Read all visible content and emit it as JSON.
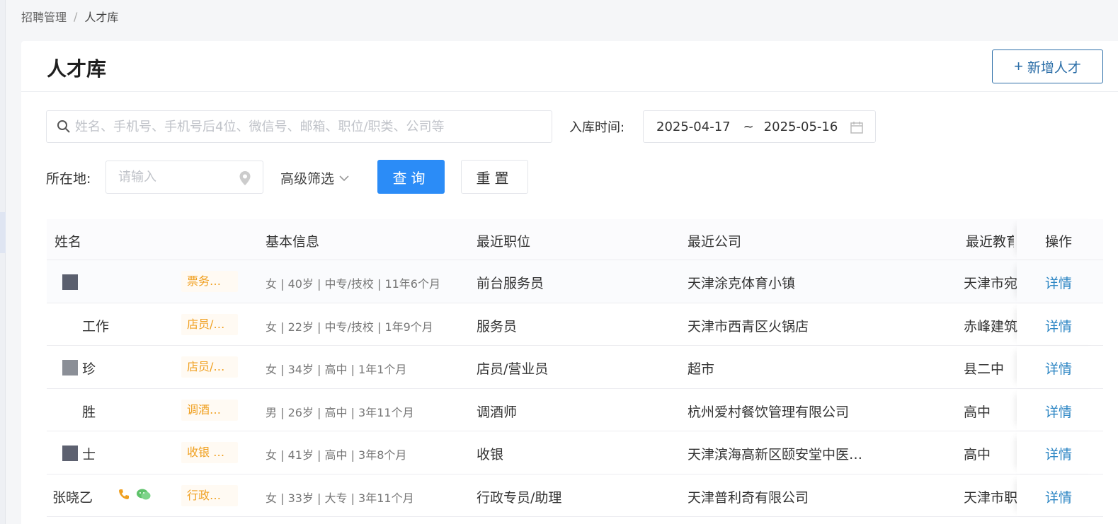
{
  "breadcrumb": {
    "parent": "招聘管理",
    "separator": "/",
    "current": "人才库"
  },
  "page_title": "人才库",
  "add_button": {
    "plus": "+",
    "label": "新增人才"
  },
  "search": {
    "placeholder": "姓名、手机号、手机号后4位、微信号、邮箱、职位/职类、公司等"
  },
  "date_filter": {
    "label": "入库时间:",
    "start": "2025-04-17",
    "tilde": "~",
    "end": "2025-05-16"
  },
  "location_filter": {
    "label": "所在地:",
    "placeholder": "请输入"
  },
  "advanced_filter": "高级筛选",
  "query_button": "查询",
  "reset_button": "重置",
  "table": {
    "headers": {
      "name": "姓名",
      "basic": "基本信息",
      "position": "最近职位",
      "company": "最近公司",
      "education": "最近教育",
      "action": "操作"
    },
    "rows": [
      {
        "name": "",
        "tag": "票务…",
        "basic": "女 | 40岁 | 中专/技校 | 11年6个月",
        "position": "前台服务员",
        "company": "天津涂克体育小镇",
        "education": "天津市宛",
        "action": "详情",
        "avatar_color": "#5a5f6e"
      },
      {
        "name": "工作",
        "tag": "店员/…",
        "basic": "女 | 22岁 | 中专/技校 | 1年9个月",
        "position": "服务员",
        "company": "天津市西青区火锅店",
        "education": "赤峰建筑",
        "action": "详情",
        "avatar_color": ""
      },
      {
        "name": "珍",
        "tag": "店员/…",
        "basic": "女 | 34岁 | 高中 | 1年1个月",
        "position": "店员/营业员",
        "company": "超市",
        "education": "县二中",
        "action": "详情",
        "avatar_color": "#8b8f97"
      },
      {
        "name": "胜",
        "tag": "调酒…",
        "basic": "男 | 26岁 | 高中 | 3年11个月",
        "position": "调酒师",
        "company": "杭州爱村餐饮管理有限公司",
        "education": "高中",
        "action": "详情",
        "avatar_color": ""
      },
      {
        "name": "士",
        "tag": "收银 …",
        "basic": "女 | 41岁 | 高中 | 3年8个月",
        "position": "收银",
        "company": "天津滨海高新区颐安堂中医…",
        "education": "高中",
        "action": "详情",
        "avatar_color": "#5d6170"
      },
      {
        "name": "张晓乙",
        "tag": "行政…",
        "basic": "女 | 33岁 | 大专 | 3年11个月",
        "position": "行政专员/助理",
        "company": "天津普利奇有限公司",
        "education": "天津市职",
        "action": "详情",
        "avatar_color": ""
      }
    ]
  },
  "colors": {
    "primary": "#2b8cf7",
    "link": "#2d86c4",
    "tag": "#f0a020",
    "add_border": "#2d6fa8"
  }
}
